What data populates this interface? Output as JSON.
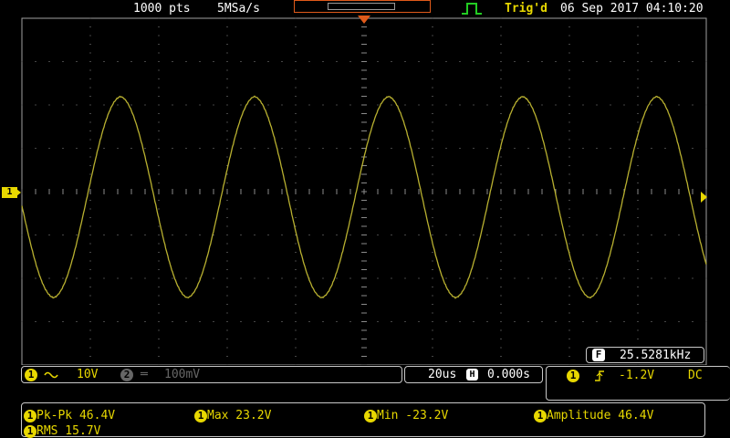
{
  "top": {
    "points": "1000 pts",
    "sample_rate": "5MSa/s",
    "trigger_status": "Trig'd",
    "datetime": "06 Sep 2017 04:10:20"
  },
  "channel_marker": {
    "label": "1"
  },
  "frequency": {
    "icon": "F",
    "value": "25.5281kHz"
  },
  "channel1": {
    "badge": "1",
    "coupling_icon": "ac-coupling-icon",
    "scale": "10V"
  },
  "channel2": {
    "badge": "2",
    "coupling_icon": "dc-coupling-icon",
    "scale": "100mV"
  },
  "timebase": {
    "scale": "20us",
    "icon": "H",
    "offset": "0.000s"
  },
  "trigger": {
    "badge": "1",
    "edge_icon": "rising-edge-icon",
    "level": "-1.2V",
    "coupling": "DC"
  },
  "measurements": [
    {
      "badge": "1",
      "text": "Pk-Pk 46.4V"
    },
    {
      "badge": "1",
      "text": "Max 23.2V"
    },
    {
      "badge": "1",
      "text": "Min -23.2V"
    },
    {
      "badge": "1",
      "text": "Amplitude 46.4V"
    },
    {
      "badge": "1",
      "text": "RMS 15.7V"
    }
  ],
  "colors": {
    "channel1": "#e8d800",
    "trace": "#b8b030",
    "trigger_marker": "#e05a1a",
    "trig_status": "#e8d800",
    "grid": "#a0a0a0"
  }
}
